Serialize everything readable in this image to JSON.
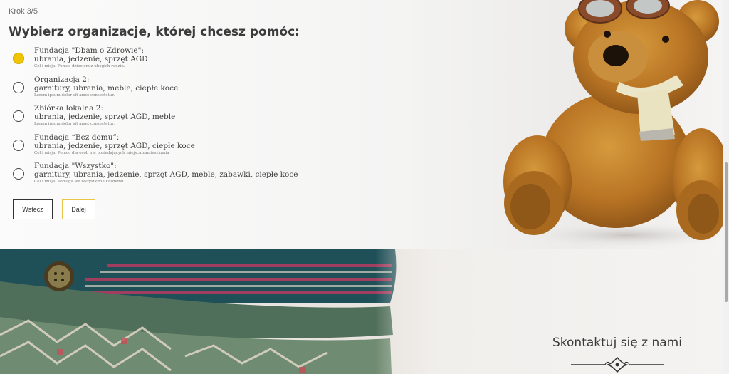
{
  "form": {
    "step": "Krok 3/5",
    "title": "Wybierz organizacje, której chcesz pomóc:",
    "options": [
      {
        "name": "Fundacja \"Dbam o Zdrowie\":",
        "categories": "ubrania, jedzenie, sprzęt AGD",
        "description": "Cel i misja: Pomoc dzieciom z ubogich rodzin.",
        "selected": true
      },
      {
        "name": "Organizacja 2:",
        "categories": "garnitury, ubrania, meble, ciepłe koce",
        "description": "Lorem ipsum dolor sit amet consectetur.",
        "selected": false
      },
      {
        "name": "Zbiórka lokalna 2:",
        "categories": "ubrania, jedzenie, sprzęt AGD, meble",
        "description": "Lorem ipsum dolor sit amet consectetur.",
        "selected": false
      },
      {
        "name": "Fundacja “Bez domu”:",
        "categories": "ubrania, jedzenie, sprzęt AGD, ciepłe koce",
        "description": "Cel i misja: Pomoc dla osób nie posiadających miejsca zamieszkania",
        "selected": false
      },
      {
        "name": "Fundacja \"Wszystko\":",
        "categories": "garnitury, ubrania, jedzenie, sprzęt AGD, meble, zabawki, ciepłe koce",
        "description": "Cel i misja: Pomaga we wszystkim i każdemu.",
        "selected": false
      }
    ],
    "back_label": "Wstecz",
    "next_label": "Dalej"
  },
  "contact": {
    "title": "Skontaktuj się z nami"
  },
  "colors": {
    "accent": "#f0c400",
    "text": "#3b3b3b"
  },
  "icons": {
    "hero_image": "teddy-bear-image",
    "background_image": "folded-sweaters-image",
    "ornament": "decorative-ornament-icon"
  }
}
